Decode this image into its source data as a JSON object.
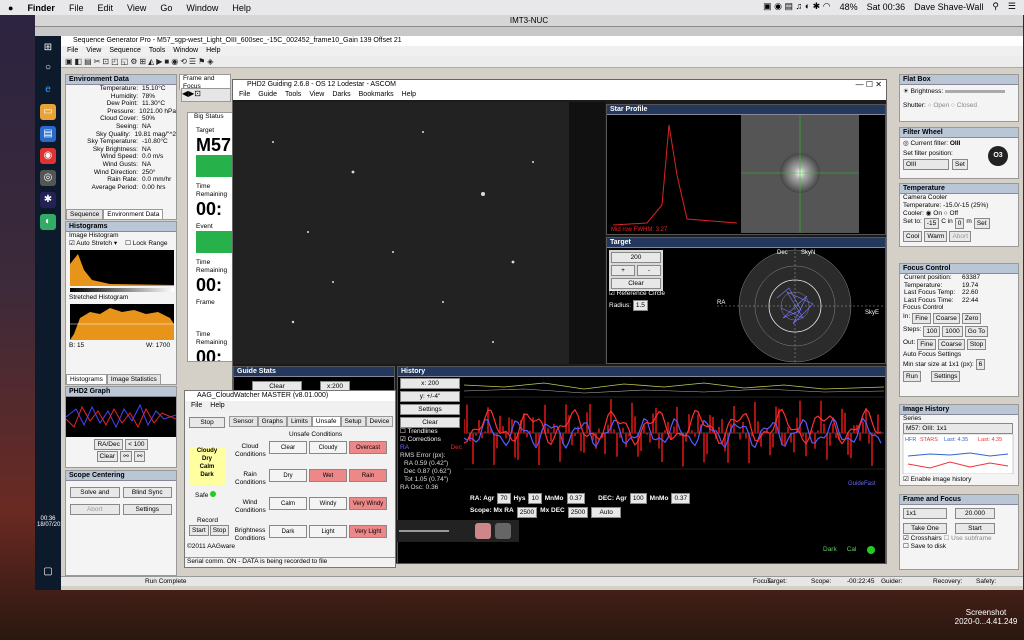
{
  "mac": {
    "apple": "",
    "app": "Finder",
    "menu": [
      "File",
      "Edit",
      "View",
      "Go",
      "Window",
      "Help"
    ],
    "battery": "48%",
    "time": "Sat 00:36",
    "user": "Dave Shave-Wall"
  },
  "remote_title": "IMT3-NUC",
  "sgp": {
    "title": "Sequence Generator Pro - M57_sgp-west_Light_OIII_600sec_-15C_002452_frame10_Gain 139 Offset 21",
    "menu": [
      "File",
      "View",
      "Sequence",
      "Tools",
      "Window",
      "Help"
    ]
  },
  "env": {
    "title": "Environment Data",
    "rows": [
      [
        "Temperature:",
        "15.10°C"
      ],
      [
        "Humidity:",
        "78%"
      ],
      [
        "Dew Point:",
        "11.30°C"
      ],
      [
        "Pressure:",
        "1021.00 hPa"
      ],
      [
        "Cloud Cover:",
        "50%"
      ],
      [
        "Seeing:",
        "NA"
      ],
      [
        "Sky Quality:",
        "19.81 mag/\"^2"
      ],
      [
        "Sky Temperature:",
        "-10.80°C"
      ],
      [
        "Sky Brightness:",
        "NA"
      ],
      [
        "Wind Speed:",
        "0.0 m/s"
      ],
      [
        "Wind Gusts:",
        "NA"
      ],
      [
        "Wind Direction:",
        "250°"
      ],
      [
        "Rain Rate:",
        "0.0 mm/hr"
      ],
      [
        "Average Period:",
        "0.00 hrs"
      ]
    ],
    "tab1": "Sequence",
    "tab2": "Environment Data"
  },
  "hist": {
    "title": "Histograms",
    "label": "Image Histogram",
    "auto": "Auto Stretch",
    "lock": "Lock Range",
    "stretched": "Stretched Histogram",
    "b": "B: 15",
    "w": "W: 1700",
    "tab1": "Histograms",
    "tab2": "Image Statistics"
  },
  "phdgraph": {
    "title": "PHD2 Graph",
    "radec": "RA/Dec",
    "scale": "< 100",
    "clear": "Clear"
  },
  "scope": {
    "title": "Scope Centering",
    "solve": "Solve and",
    "blind": "Blind Sync",
    "abort": "Abort",
    "settings": "Settings"
  },
  "frame": {
    "tab": "Frame and Focus"
  },
  "bigstatus": {
    "title": "Big Status",
    "target": "Target",
    "target_val": "M57",
    "time_rem": "Time Remaining",
    "time_val": "00:",
    "event": "Event",
    "frame": "Frame"
  },
  "phd": {
    "title": "PHD2 Guiding 2.6.8 - OS 12 Lodestar - ASCOM",
    "menu": [
      "File",
      "Guide",
      "Tools",
      "View",
      "Darks",
      "Bookmarks",
      "Help"
    ],
    "star_profile": "Star Profile",
    "fwhm": "Mid row FWHM: 3.27",
    "target": "Target",
    "scale_val": "200",
    "clear": "Clear",
    "refcircle": "Reference Circle",
    "radius": "Radius:",
    "radius_val": "1.5",
    "guide_stats": "Guide Stats",
    "clear2": "Clear",
    "x200": "x:200",
    "history": "History",
    "hx": "x: 200",
    "hy": "y: +/-4\"",
    "hsettings": "Settings",
    "hclear": "Clear",
    "trendlines": "Trendlines",
    "corrections": "Corrections",
    "ra": "RA",
    "dec": "Dec",
    "rms": "RMS Error (px):",
    "rms_ra": "RA 0.59 (0.42\")",
    "rms_dec": "Dec 0.87 (0.62\")",
    "rms_tot": "Tot 1.05 (0.74\")",
    "raosc": "RA Osc: 0.36",
    "ra_agr": "RA: Agr",
    "ra_agr_val": "70",
    "hys": "Hys",
    "hys_val": "10",
    "minmo": "MnMo",
    "minmo_val": "0.37",
    "dec_agr": "DEC: Agr",
    "dec_agr_val": "100",
    "dminmo_val": "0.37",
    "scope_ms": "Scope: Mx RA",
    "mxra": "2500",
    "mxdec": "Mx DEC",
    "mxdec_val": "2500",
    "auto": "Auto",
    "guidefast": "GuideFast",
    "dark": "Dark",
    "cal": "Cal",
    "dec_lbl": "Dec",
    "skyn": "SkyN",
    "skye": "SkyE",
    "ra_lbl": "RA"
  },
  "cw": {
    "title": "AAG_CloudWatcher MASTER (v8.01.000)",
    "menu": [
      "File",
      "Help"
    ],
    "stop": "Stop",
    "tabs": [
      "Sensor",
      "Graphs",
      "Limits",
      "Unsafe",
      "Setup",
      "Device"
    ],
    "unsafe": "Unsafe Conditions",
    "cloud": "Cloud Conditions",
    "rain": "Rain Conditions",
    "wind": "Wind Conditions",
    "bright": "Brightness Conditions",
    "status": [
      "Cloudy",
      "Dry",
      "Calm",
      "Dark"
    ],
    "safe": "Safe",
    "record": "Record",
    "start": "Start",
    "stop2": "Stop",
    "copyright": "©2011 AAGware",
    "serial": "Serial comm. ON - DATA is being recorded to file",
    "c_clear": "Clear",
    "c_cloudy": "Cloudy",
    "c_overc": "Overcast",
    "r_dry": "Dry",
    "r_wet": "Wet",
    "r_rain": "Rain",
    "w_calm": "Calm",
    "w_windy": "Windy",
    "w_vwindy": "Very Windy",
    "b_dark": "Dark",
    "b_light": "Light",
    "b_vlight": "Very Light"
  },
  "flat": {
    "title": "Flat Box",
    "brightness": "Brightness:",
    "shutter": "Shutter:",
    "open": "Open",
    "closed": "Closed"
  },
  "fw": {
    "title": "Filter Wheel",
    "current": "Current filter:",
    "current_val": "OIII",
    "set_pos": "Set filter position:",
    "sel": "OIII",
    "set": "Set",
    "badge": "O3"
  },
  "temp": {
    "title": "Temperature",
    "cooler_lbl": "Camera Cooler",
    "temp": "Temperature: -15.0/-15 (25%)",
    "cooler": "Cooler:",
    "on": "On",
    "off": "Off",
    "setto": "Set to:",
    "setto_val": "-15",
    "cin": "C in",
    "cin_val": "0",
    "m": "m",
    "set": "Set",
    "cool": "Cool",
    "warm": "Warm",
    "abort": "Abort"
  },
  "focus": {
    "title": "Focus Control",
    "pos": "Current position:",
    "pos_val": "63387",
    "temp": "Temperature:",
    "temp_val": "19.74",
    "lft": "Last Focus Temp:",
    "lft_val": "22.60",
    "lftime": "Last Focus Time:",
    "lftime_val": "22:44",
    "fc": "Focus Control",
    "in": "In:",
    "fine": "Fine",
    "coarse": "Coarse",
    "zero": "Zero",
    "steps": "Steps:",
    "s1": "100",
    "s2": "1000",
    "goto": "Go To",
    "out": "Out:",
    "stop": "Stop",
    "afs": "Auto Focus Settings",
    "minstar": "Min star size at 1x1 (px):",
    "minstar_val": "6",
    "run": "Run",
    "settings": "Settings"
  },
  "ih": {
    "title": "Image History",
    "series": "Series",
    "series_val": "M57: OIII: 1x1",
    "hfr": "HFR",
    "stars": "STARS",
    "last1": "Last: 4.35",
    "last2": "Last: 4.35",
    "enable": "Enable image history"
  },
  "ff": {
    "title": "Frame and Focus",
    "bin": "1x1",
    "exp": "20.000",
    "take": "Take One",
    "start": "Start",
    "cross": "Crosshairs",
    "subframe": "Use subframe",
    "save": "Save to disk"
  },
  "status": {
    "run": "Run Complete",
    "focus": "Focus:",
    "target": "Target:",
    "scope": "Scope:",
    "time": "-00:22:45",
    "guider": "Guider:",
    "recovery": "Recovery:",
    "safety": "Safety:"
  },
  "win_clock": {
    "time": "00:36",
    "date": "18/07/2020"
  },
  "shot": {
    "label": "Screenshot",
    "date": "2020-0...4.41.249"
  }
}
